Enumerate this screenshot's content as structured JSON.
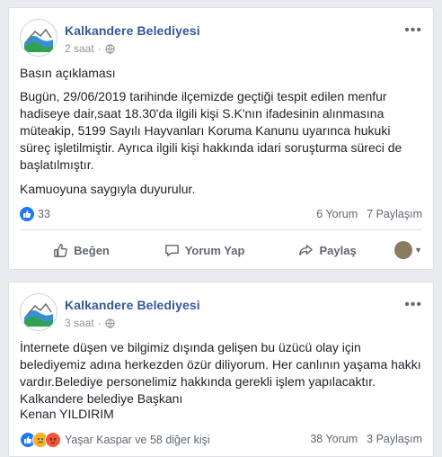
{
  "posts": [
    {
      "page_name": "Kalkandere Belediyesi",
      "time": "2 saat",
      "body_paragraphs": [
        "Basın açıklaması",
        "Bugün, 29/06/2019 tarihinde ilçemizde geçtiği tespit edilen menfur hadiseye dair,saat 18.30'da ilgili kişi S.K'nın ifadesinin alınmasına müteakip, 5199 Sayılı Hayvanları Koruma Kanunu uyarınca hukuki süreç işletilmiştir. Ayrıca ilgili kişi hakkında idari soruşturma süreci de başlatılmıştır.",
        "Kamuoyuna saygıyla duyurulur."
      ],
      "reaction_count": "33",
      "comments": "6 Yorum",
      "shares": "7 Paylaşım",
      "actions": {
        "like": "Beğen",
        "comment": "Yorum Yap",
        "share": "Paylaş"
      }
    },
    {
      "page_name": "Kalkandere Belediyesi",
      "time": "3 saat",
      "body_paragraphs": [
        "İnternete düşen ve bilgimiz dışında gelişen bu üzücü olay için belediyemiz adına herkezden özür diliyorum. Her canlının yaşama hakkı vardır.Belediye personelimiz hakkında gerekli işlem yapılacaktır.",
        "Kalkandere belediye Başkanı",
        "Kenan YILDIRIM"
      ],
      "reaction_text": "Yaşar Kaspar ve 58 diğer kişi",
      "comments": "38 Yorum",
      "shares": "3 Paylaşım"
    }
  ],
  "colors": {
    "link": "#365899",
    "meta": "#90949c",
    "like_blue": "#2078f4",
    "angry": "#f0573a",
    "sad": "#f7b125"
  }
}
